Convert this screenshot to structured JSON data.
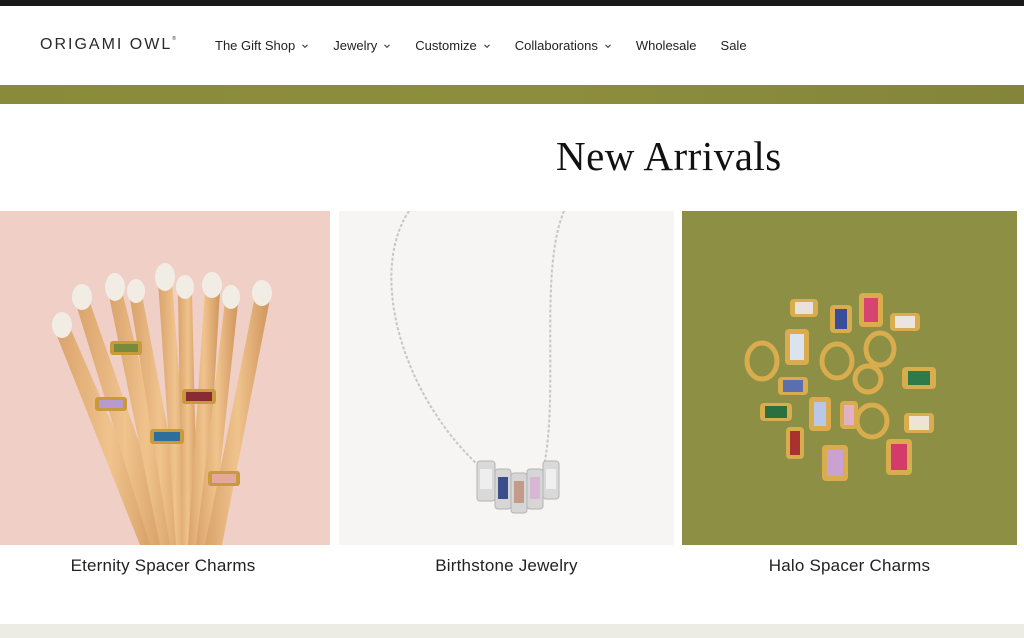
{
  "brand": {
    "logo_text": "ORIGAMI OWL",
    "logo_mark": "®"
  },
  "nav": {
    "items": [
      {
        "label": "The Gift Shop",
        "has_dropdown": true
      },
      {
        "label": "Jewelry",
        "has_dropdown": true
      },
      {
        "label": "Customize",
        "has_dropdown": true
      },
      {
        "label": "Collaborations",
        "has_dropdown": true
      },
      {
        "label": "Wholesale",
        "has_dropdown": false
      },
      {
        "label": "Sale",
        "has_dropdown": false
      }
    ]
  },
  "main": {
    "title": "New Arrivals",
    "cards": [
      {
        "label": "Eternity Spacer Charms",
        "bg": "#f0cfc6"
      },
      {
        "label": "Birthstone Jewelry",
        "bg": "#f6f5f3"
      },
      {
        "label": "Halo Spacer Charms",
        "bg": "#8d8f45"
      }
    ]
  },
  "colors": {
    "olive": "#8a8b3a",
    "top_strip": "#1a1a1a"
  }
}
